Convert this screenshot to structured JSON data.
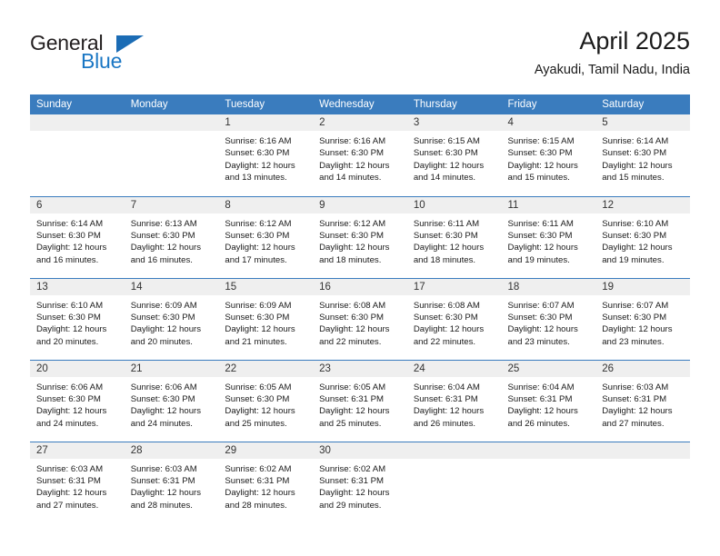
{
  "brand": {
    "name_part1": "General",
    "name_part2": "Blue",
    "triangle_icon": "triangle-icon",
    "accent_color": "#1b77c4"
  },
  "header": {
    "title": "April 2025",
    "subtitle": "Ayakudi, Tamil Nadu, India"
  },
  "calendar": {
    "header_bg": "#3a7cbe",
    "daynum_bg": "#efefef",
    "weekday_headers": [
      "Sunday",
      "Monday",
      "Tuesday",
      "Wednesday",
      "Thursday",
      "Friday",
      "Saturday"
    ],
    "weeks": [
      [
        {
          "day": "",
          "lines": []
        },
        {
          "day": "",
          "lines": []
        },
        {
          "day": "1",
          "lines": [
            "Sunrise: 6:16 AM",
            "Sunset: 6:30 PM",
            "Daylight: 12 hours",
            "and 13 minutes."
          ]
        },
        {
          "day": "2",
          "lines": [
            "Sunrise: 6:16 AM",
            "Sunset: 6:30 PM",
            "Daylight: 12 hours",
            "and 14 minutes."
          ]
        },
        {
          "day": "3",
          "lines": [
            "Sunrise: 6:15 AM",
            "Sunset: 6:30 PM",
            "Daylight: 12 hours",
            "and 14 minutes."
          ]
        },
        {
          "day": "4",
          "lines": [
            "Sunrise: 6:15 AM",
            "Sunset: 6:30 PM",
            "Daylight: 12 hours",
            "and 15 minutes."
          ]
        },
        {
          "day": "5",
          "lines": [
            "Sunrise: 6:14 AM",
            "Sunset: 6:30 PM",
            "Daylight: 12 hours",
            "and 15 minutes."
          ]
        }
      ],
      [
        {
          "day": "6",
          "lines": [
            "Sunrise: 6:14 AM",
            "Sunset: 6:30 PM",
            "Daylight: 12 hours",
            "and 16 minutes."
          ]
        },
        {
          "day": "7",
          "lines": [
            "Sunrise: 6:13 AM",
            "Sunset: 6:30 PM",
            "Daylight: 12 hours",
            "and 16 minutes."
          ]
        },
        {
          "day": "8",
          "lines": [
            "Sunrise: 6:12 AM",
            "Sunset: 6:30 PM",
            "Daylight: 12 hours",
            "and 17 minutes."
          ]
        },
        {
          "day": "9",
          "lines": [
            "Sunrise: 6:12 AM",
            "Sunset: 6:30 PM",
            "Daylight: 12 hours",
            "and 18 minutes."
          ]
        },
        {
          "day": "10",
          "lines": [
            "Sunrise: 6:11 AM",
            "Sunset: 6:30 PM",
            "Daylight: 12 hours",
            "and 18 minutes."
          ]
        },
        {
          "day": "11",
          "lines": [
            "Sunrise: 6:11 AM",
            "Sunset: 6:30 PM",
            "Daylight: 12 hours",
            "and 19 minutes."
          ]
        },
        {
          "day": "12",
          "lines": [
            "Sunrise: 6:10 AM",
            "Sunset: 6:30 PM",
            "Daylight: 12 hours",
            "and 19 minutes."
          ]
        }
      ],
      [
        {
          "day": "13",
          "lines": [
            "Sunrise: 6:10 AM",
            "Sunset: 6:30 PM",
            "Daylight: 12 hours",
            "and 20 minutes."
          ]
        },
        {
          "day": "14",
          "lines": [
            "Sunrise: 6:09 AM",
            "Sunset: 6:30 PM",
            "Daylight: 12 hours",
            "and 20 minutes."
          ]
        },
        {
          "day": "15",
          "lines": [
            "Sunrise: 6:09 AM",
            "Sunset: 6:30 PM",
            "Daylight: 12 hours",
            "and 21 minutes."
          ]
        },
        {
          "day": "16",
          "lines": [
            "Sunrise: 6:08 AM",
            "Sunset: 6:30 PM",
            "Daylight: 12 hours",
            "and 22 minutes."
          ]
        },
        {
          "day": "17",
          "lines": [
            "Sunrise: 6:08 AM",
            "Sunset: 6:30 PM",
            "Daylight: 12 hours",
            "and 22 minutes."
          ]
        },
        {
          "day": "18",
          "lines": [
            "Sunrise: 6:07 AM",
            "Sunset: 6:30 PM",
            "Daylight: 12 hours",
            "and 23 minutes."
          ]
        },
        {
          "day": "19",
          "lines": [
            "Sunrise: 6:07 AM",
            "Sunset: 6:30 PM",
            "Daylight: 12 hours",
            "and 23 minutes."
          ]
        }
      ],
      [
        {
          "day": "20",
          "lines": [
            "Sunrise: 6:06 AM",
            "Sunset: 6:30 PM",
            "Daylight: 12 hours",
            "and 24 minutes."
          ]
        },
        {
          "day": "21",
          "lines": [
            "Sunrise: 6:06 AM",
            "Sunset: 6:30 PM",
            "Daylight: 12 hours",
            "and 24 minutes."
          ]
        },
        {
          "day": "22",
          "lines": [
            "Sunrise: 6:05 AM",
            "Sunset: 6:30 PM",
            "Daylight: 12 hours",
            "and 25 minutes."
          ]
        },
        {
          "day": "23",
          "lines": [
            "Sunrise: 6:05 AM",
            "Sunset: 6:31 PM",
            "Daylight: 12 hours",
            "and 25 minutes."
          ]
        },
        {
          "day": "24",
          "lines": [
            "Sunrise: 6:04 AM",
            "Sunset: 6:31 PM",
            "Daylight: 12 hours",
            "and 26 minutes."
          ]
        },
        {
          "day": "25",
          "lines": [
            "Sunrise: 6:04 AM",
            "Sunset: 6:31 PM",
            "Daylight: 12 hours",
            "and 26 minutes."
          ]
        },
        {
          "day": "26",
          "lines": [
            "Sunrise: 6:03 AM",
            "Sunset: 6:31 PM",
            "Daylight: 12 hours",
            "and 27 minutes."
          ]
        }
      ],
      [
        {
          "day": "27",
          "lines": [
            "Sunrise: 6:03 AM",
            "Sunset: 6:31 PM",
            "Daylight: 12 hours",
            "and 27 minutes."
          ]
        },
        {
          "day": "28",
          "lines": [
            "Sunrise: 6:03 AM",
            "Sunset: 6:31 PM",
            "Daylight: 12 hours",
            "and 28 minutes."
          ]
        },
        {
          "day": "29",
          "lines": [
            "Sunrise: 6:02 AM",
            "Sunset: 6:31 PM",
            "Daylight: 12 hours",
            "and 28 minutes."
          ]
        },
        {
          "day": "30",
          "lines": [
            "Sunrise: 6:02 AM",
            "Sunset: 6:31 PM",
            "Daylight: 12 hours",
            "and 29 minutes."
          ]
        },
        {
          "day": "",
          "lines": []
        },
        {
          "day": "",
          "lines": []
        },
        {
          "day": "",
          "lines": []
        }
      ]
    ]
  }
}
